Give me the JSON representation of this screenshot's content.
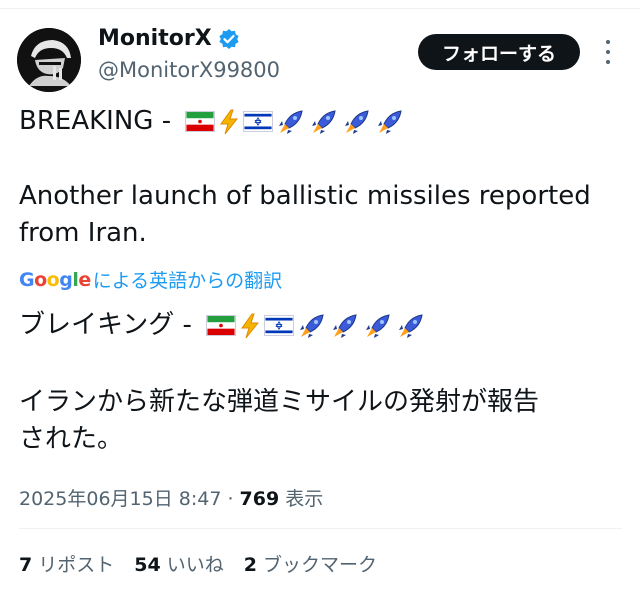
{
  "user": {
    "name": "MonitorX",
    "handle": "@MonitorX99800",
    "verified": true
  },
  "header": {
    "follow_label": "フォローする"
  },
  "tweet": {
    "original_prefix": "BREAKING -",
    "original_body_line1": "Another launch of ballistic missiles reported",
    "original_body_line2": "from Iran.",
    "translation_link": "による英語からの翻訳",
    "google_label": "Google",
    "translated_prefix": "ブレイキング -",
    "translated_body_line1": "イランから新たな弾道ミサイルの発射が報告",
    "translated_body_line2": "された。"
  },
  "meta": {
    "timestamp": "2025年06月15日 8:47 · ",
    "views_count": "769",
    "views_label": " 表示"
  },
  "stats": {
    "reposts_count": "7",
    "reposts_label": "リポスト",
    "likes_count": "54",
    "likes_label": "いいね",
    "bookmarks_count": "2",
    "bookmarks_label": "ブックマーク"
  },
  "icons": {
    "verified": "verified-badge-icon",
    "lightning": "lightning-icon",
    "rocket": "rocket-icon",
    "iran_flag": "iran-flag-icon",
    "israel_flag": "israel-flag-icon"
  },
  "colors": {
    "accent": "#1d9bf0",
    "text": "#0f1419",
    "muted": "#536471",
    "button_bg": "#0f1419"
  }
}
